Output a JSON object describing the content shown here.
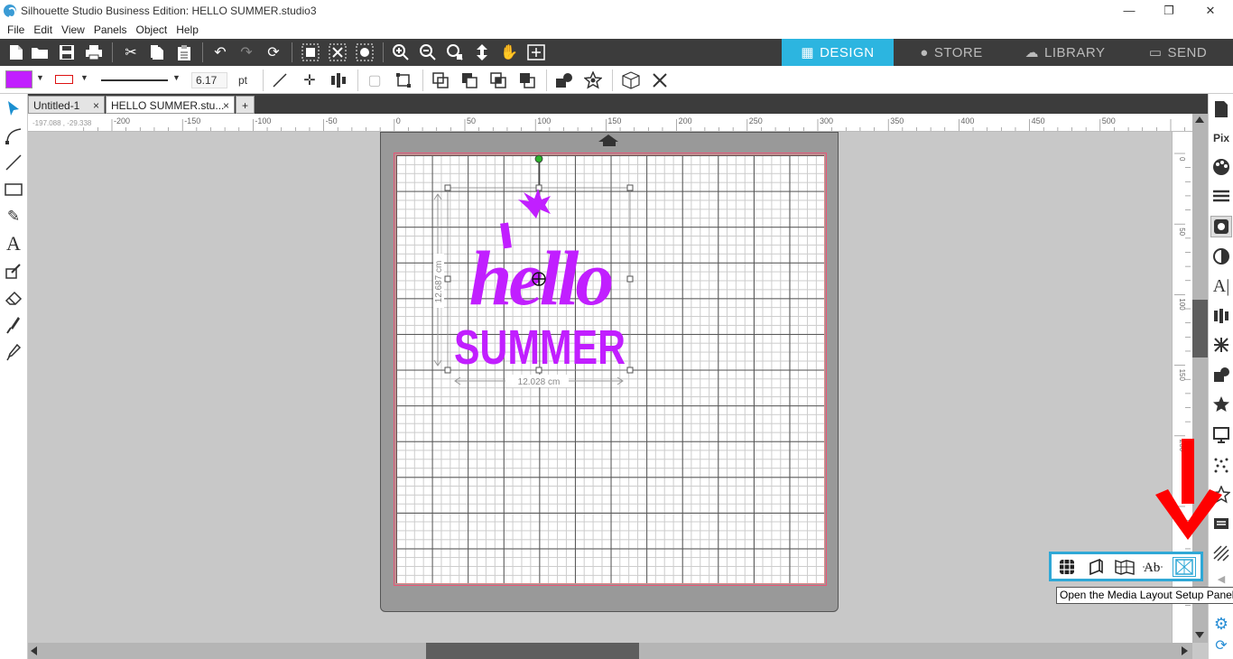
{
  "window": {
    "title": "Silhouette Studio Business Edition: HELLO SUMMER.studio3",
    "minimize": "—",
    "restore": "❐",
    "close": "✕"
  },
  "menu": [
    "File",
    "Edit",
    "View",
    "Panels",
    "Object",
    "Help"
  ],
  "nav_tabs": [
    {
      "label": "DESIGN",
      "icon": "design-grid-icon",
      "active": true
    },
    {
      "label": "STORE",
      "icon": "store-s-icon",
      "active": false
    },
    {
      "label": "LIBRARY",
      "icon": "library-cloud-icon",
      "active": false
    },
    {
      "label": "SEND",
      "icon": "send-machine-icon",
      "active": false
    }
  ],
  "properties": {
    "fill_color": "#c11fff",
    "line_color": "#dd1111",
    "line_width": "6.17",
    "line_unit": "pt"
  },
  "doc_tabs": [
    {
      "label": "Untitled-1",
      "close": "×",
      "active": false
    },
    {
      "label": "HELLO SUMMER.stu...",
      "close": "×",
      "active": true
    },
    {
      "label": "+",
      "close": "",
      "active": false
    }
  ],
  "ruler": {
    "coords": "-197.088 , -29.338",
    "h_labels": [
      "-200",
      "-150",
      "-100",
      "-50",
      "0",
      "50",
      "100",
      "150",
      "200",
      "250",
      "300",
      "350",
      "400",
      "450",
      "500"
    ],
    "v_labels": [
      "0",
      "50",
      "100",
      "150",
      "200"
    ]
  },
  "design": {
    "word1": "hello",
    "word2": "SUMMER",
    "color": "#c11fff",
    "height_label": "12.687 cm",
    "width_label": "12.028 cm"
  },
  "media_panel": {
    "buttons": [
      "page-setup-icon",
      "print-cut-icon",
      "media-warp-icon",
      "text-style-icon",
      "media-layout-icon"
    ],
    "tooltip": "Open the Media Layout Setup Panel"
  },
  "accent_color": "#2cb5e0"
}
